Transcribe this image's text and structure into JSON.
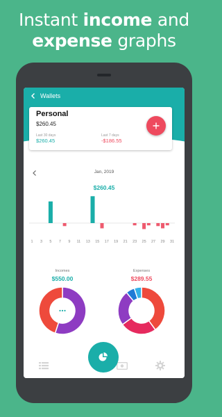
{
  "headline": {
    "line1_prefix": "Instant ",
    "line1_bold": "income",
    "line1_suffix": " and",
    "line2_bold": "expense",
    "line2_suffix": " graphs"
  },
  "topbar": {
    "title": "Wallets",
    "back_icon": "back-arrow-icon"
  },
  "wallet_card": {
    "name": "Personal",
    "balance": "$260.45",
    "last30_label": "Last 30 days",
    "last30_value": "$260.45",
    "last7_label": "Last 7 days",
    "last7_value": "-$186.55",
    "add_icon": "plus-icon"
  },
  "period": {
    "month": "Jan, 2019",
    "prev_icon": "chevron-left-icon"
  },
  "total": "$260.45",
  "incomes": {
    "label": "Incomes",
    "value": "$550.00"
  },
  "expenses": {
    "label": "Expenses",
    "value": "$289.55"
  },
  "colors": {
    "teal": "#1aaea9",
    "income_bar": "#1aaea9",
    "expense_bar": "#ee5a6e",
    "negative": "#ee4a5e"
  },
  "chart_data": [
    {
      "type": "bar",
      "title": "",
      "x_ticks": [
        "1",
        "3",
        "5",
        "7",
        "9",
        "11",
        "13",
        "15",
        "17",
        "19",
        "21",
        "23",
        "25",
        "27",
        "29",
        "31"
      ],
      "x": [
        5,
        8,
        14,
        16,
        23,
        25,
        26,
        28,
        29,
        30
      ],
      "values": [
        145,
        -20,
        180,
        -35,
        -15,
        -40,
        -15,
        -20,
        -35,
        -15
      ],
      "ylim": [
        -60,
        200
      ],
      "grid": false
    },
    {
      "type": "pie",
      "title": "Incomes",
      "slices": [
        {
          "value": 55,
          "color": "#8e3cc2"
        },
        {
          "value": 45,
          "color": "#ee4a3c"
        }
      ]
    },
    {
      "type": "pie",
      "title": "Expenses",
      "slices": [
        {
          "value": 40,
          "color": "#ee4a3c"
        },
        {
          "value": 25,
          "color": "#e62a5e"
        },
        {
          "value": 24,
          "color": "#8e3cc2"
        },
        {
          "value": 6,
          "color": "#1f7ad6"
        },
        {
          "value": 5,
          "color": "#34b0e8"
        }
      ]
    }
  ],
  "nav": {
    "items": [
      {
        "icon": "list-icon"
      },
      {
        "icon": "pie-chart-icon"
      },
      {
        "icon": "money-icon"
      },
      {
        "icon": "gear-icon"
      }
    ]
  }
}
